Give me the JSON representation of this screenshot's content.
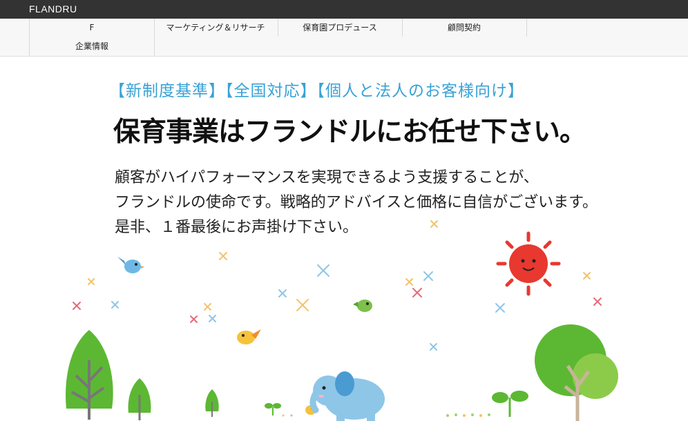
{
  "header": {
    "brand": "FLANDRU"
  },
  "nav": {
    "items": [
      {
        "label": "F"
      },
      {
        "label": "マーケティング＆リサーチ"
      },
      {
        "label": "保育園プロデュース"
      },
      {
        "label": "顧問契約"
      },
      {
        "label": "企業情報"
      }
    ]
  },
  "hero": {
    "tagline": "【新制度基準】【全国対応】【個人と法人のお客様向け】",
    "headline": "保育事業はフランドルにお任せ下さい。",
    "lead": [
      "顧客がハイパフォーマンスを実現できるよう支援することが、",
      "フランドルの使命です。戦略的アドバイスと価格に自信がございます。",
      "是非、１番最後にお声掛け下さい。"
    ]
  },
  "colors": {
    "topbar": "#333333",
    "tagline": "#38a2d6",
    "sun": "#e8382f",
    "tree_green": "#5cb833",
    "elephant": "#8ec6e8"
  }
}
